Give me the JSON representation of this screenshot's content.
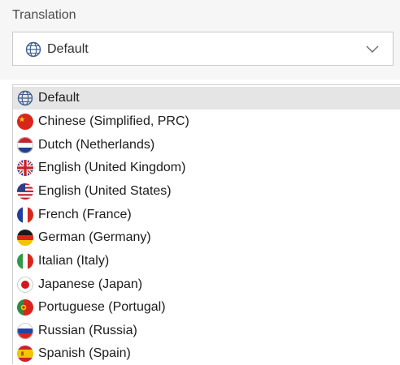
{
  "section": {
    "label": "Translation"
  },
  "select": {
    "value": "Default",
    "icon": "globe-icon",
    "chevron": "chevron-down-icon"
  },
  "options": [
    {
      "label": "Default",
      "icon": "globe-icon",
      "selected": true
    },
    {
      "label": "Chinese (Simplified, PRC)",
      "icon": "flag-china-icon"
    },
    {
      "label": "Dutch (Netherlands)",
      "icon": "flag-netherlands-icon"
    },
    {
      "label": "English (United Kingdom)",
      "icon": "flag-uk-icon"
    },
    {
      "label": "English (United States)",
      "icon": "flag-us-icon"
    },
    {
      "label": "French (France)",
      "icon": "flag-france-icon"
    },
    {
      "label": "German (Germany)",
      "icon": "flag-germany-icon"
    },
    {
      "label": "Italian (Italy)",
      "icon": "flag-italy-icon"
    },
    {
      "label": "Japanese (Japan)",
      "icon": "flag-japan-icon"
    },
    {
      "label": "Portuguese (Portugal)",
      "icon": "flag-portugal-icon"
    },
    {
      "label": "Russian (Russia)",
      "icon": "flag-russia-icon"
    },
    {
      "label": "Spanish (Spain)",
      "icon": "flag-spain-icon"
    }
  ],
  "colors": {
    "selected_row": "#e5e5e5",
    "top_band": "#f6f6f6",
    "border": "#c9c9c9"
  }
}
